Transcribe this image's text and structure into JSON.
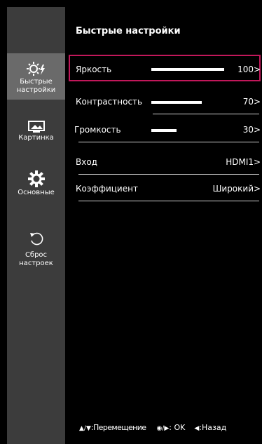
{
  "menu": {
    "title": "Быстрые настройки",
    "sidebar": [
      {
        "label_line1": "Быстрые",
        "label_line2": "настройки",
        "icon": "quick-settings-icon",
        "active": true
      },
      {
        "label_line1": "Картинка",
        "label_line2": "",
        "icon": "picture-icon",
        "active": false
      },
      {
        "label_line1": "Основные",
        "label_line2": "",
        "icon": "gear-icon",
        "active": false
      },
      {
        "label_line1": "Сброс",
        "label_line2": "настроек",
        "icon": "reset-icon",
        "active": false
      }
    ],
    "rows": [
      {
        "name": "Яркость",
        "value": "100",
        "level": 100,
        "selected": true
      },
      {
        "name": "Контрастность",
        "value": "70",
        "level": 70,
        "selected": false
      },
      {
        "name": "Громкость",
        "value": "30",
        "level": 30,
        "selected": false
      },
      {
        "name": "Вход",
        "value": "HDMI1",
        "selected": false
      },
      {
        "name": "Коэффициент",
        "value": "Широкий",
        "selected": false
      }
    ],
    "chevron": ">",
    "footer": {
      "move_glyphs": "▲/▼",
      "move_label": ":Перемещение",
      "ok_glyphs": "◉/▶",
      "ok_label": ": OK",
      "back_glyph": "◀",
      "back_label": ":Назад"
    },
    "colors": {
      "selection": "#c2185b",
      "sidebar": "#3c3c3c",
      "sidebar_active": "#6a6a6a"
    }
  }
}
